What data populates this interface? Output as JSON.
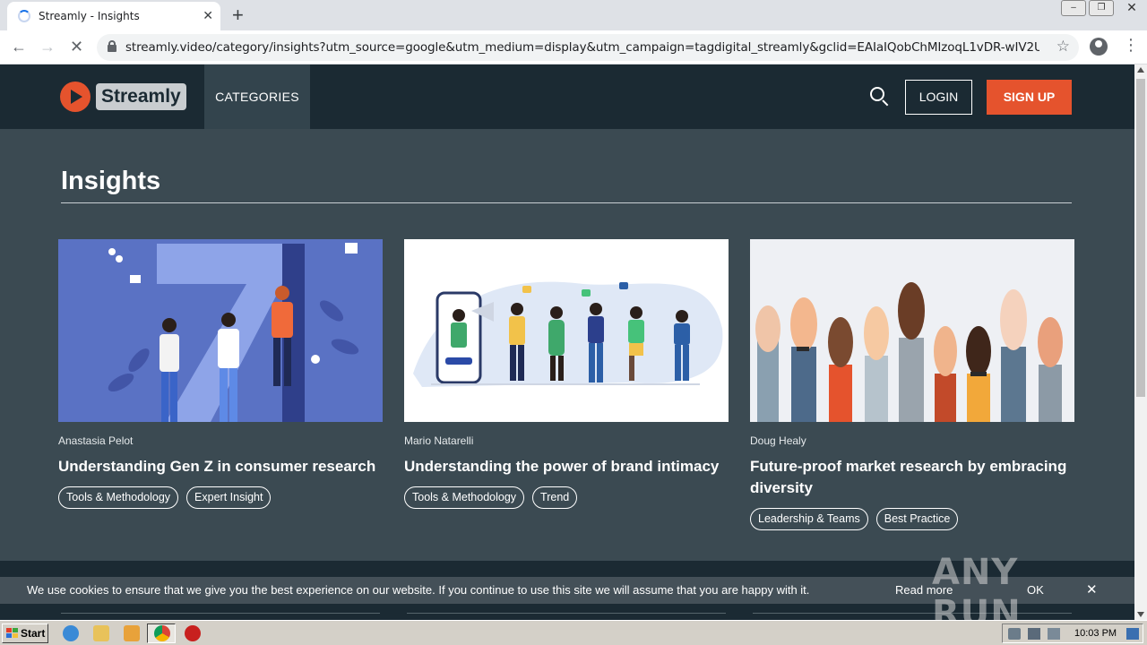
{
  "browser": {
    "tab_title": "Streamly - Insights",
    "url": "streamly.video/category/insights?utm_source=google&utm_medium=display&utm_campaign=tagdigital_streamly&gclid=EAIaIQobChMIzoqL1vDR-wIV2UTCBR1qeQ..."
  },
  "header": {
    "logo_text": "Streamly",
    "nav_categories": "CATEGORIES",
    "login_label": "LOGIN",
    "signup_label": "SIGN UP"
  },
  "page": {
    "title": "Insights"
  },
  "cards": [
    {
      "author": "Anastasia Pelot",
      "title": "Understanding Gen Z in consumer research",
      "tags": [
        "Tools & Methodology",
        "Expert Insight"
      ]
    },
    {
      "author": "Mario Natarelli",
      "title": "Understanding the power of brand intimacy",
      "tags": [
        "Tools & Methodology",
        "Trend"
      ]
    },
    {
      "author": "Doug Healy",
      "title": "Future-proof market research by embracing diversity",
      "tags": [
        "Leadership & Teams",
        "Best Practice"
      ]
    }
  ],
  "cookie": {
    "text": "We use cookies to ensure that we give you the best experience on our website. If you continue to use this site we will assume that you are happy with it.",
    "read_more": "Read more",
    "ok": "OK",
    "close": "✕"
  },
  "watermark": {
    "text": "ANY RUN"
  },
  "taskbar": {
    "start_label": "Start",
    "clock": "10:03 PM"
  },
  "colors": {
    "header_bg": "#1b2a33",
    "page_bg": "#3b4a52",
    "accent": "#e5532d"
  }
}
